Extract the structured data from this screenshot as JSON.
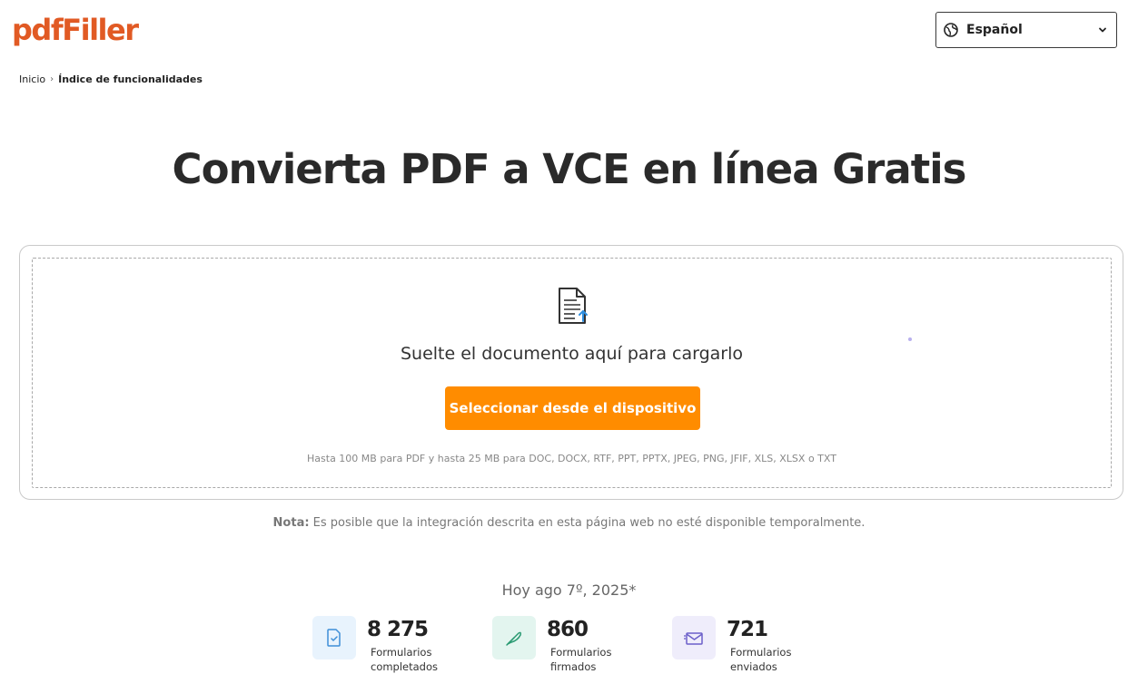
{
  "header": {
    "logo_text": "pdfFiller",
    "brand_color": "#e15a24",
    "language": {
      "label": "Español",
      "icon": "globe-icon",
      "chevron": "chevron-down-icon"
    }
  },
  "breadcrumb": {
    "home": "Inicio",
    "separator": "›",
    "current": "Índice de funcionalidades"
  },
  "page_title": "Convierta PDF a VCE en línea Gratis",
  "upload": {
    "icon": "document-upload-icon",
    "drop_text": "Suelte el documento aquí para cargarlo",
    "button_label": "Seleccionar desde el dispositivo",
    "button_color": "#ff8c00",
    "limits_text": "Hasta 100 MB para PDF y hasta 25 MB para DOC, DOCX, RTF, PPT, PPTX, JPEG, PNG, JFIF, XLS, XLSX o TXT"
  },
  "note": {
    "prefix": "Nota:",
    "text": " Es posible que la integración descrita en esta página web no esté disponible temporalmente."
  },
  "stats": {
    "date": "Hoy ago 7º, 2025*",
    "items": [
      {
        "icon": "document-check-icon",
        "value": "8 275",
        "label": "Formularios completados",
        "color": "#e8f3fd"
      },
      {
        "icon": "feather-pen-icon",
        "value": "860",
        "label": "Formularios firmados",
        "color": "#e3f5ef"
      },
      {
        "icon": "envelope-icon",
        "value": "721",
        "label": "Formularios enviados",
        "color": "#efedfb"
      }
    ]
  }
}
